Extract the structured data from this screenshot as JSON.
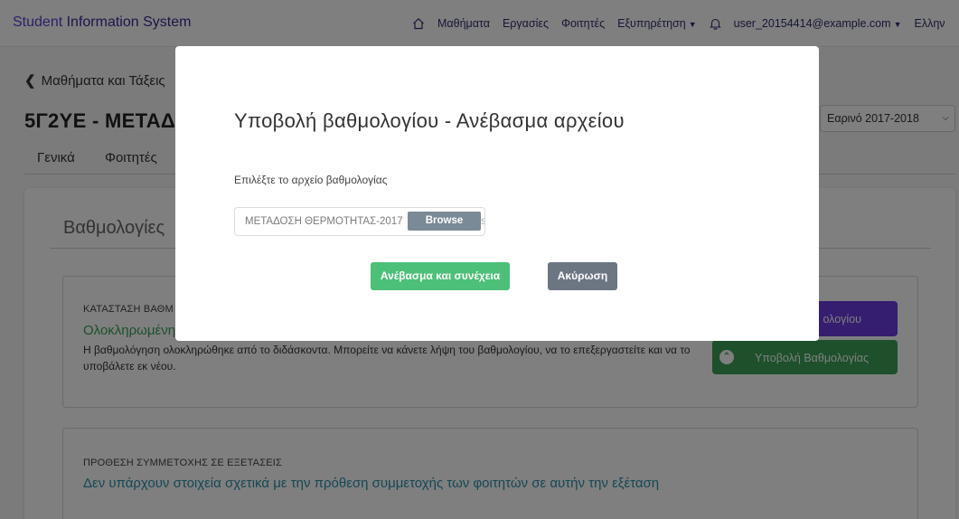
{
  "navbar": {
    "brand_part1": "Student ",
    "brand_part2": "Information System",
    "links": [
      "Μαθήματα",
      "Εργασίες",
      "Φοιτητές"
    ],
    "support_label": "Εξυπηρέτηση",
    "user_email": "user_20154414@example.com",
    "language": "Ελλην"
  },
  "page": {
    "back_label": "Μαθήματα και Τάξεις",
    "course_title": "5Γ2ΥΕ - ΜΕΤΑΔ",
    "semester": "Εαρινό 2017-2018",
    "tabs": [
      "Γενικά",
      "Φοιτητές"
    ],
    "section_title": "Βαθμολογίες",
    "status_box": {
      "label": "ΚΑΤΑΣΤΑΣΗ ΒΑΘΜ",
      "status": "Ολοκληρωμένη",
      "description": "Η βαθμολόγηση ολοκληρώθηκε από το διδάσκοντα. Μπορείτε να κάνετε λήψη του βαθμολογίου, να το επεξεργαστείτε και να το υποβάλετε εκ νέου.",
      "download_button": "ολογίου",
      "submit_button": "Υποβολή Βαθμολογίας"
    },
    "intent_box": {
      "label": "ΠΡΟΘΕΣΗ ΣΥΜΜΕΤΟΧΗΣ ΣΕ ΕΞΕΤΑΣΕΙΣ",
      "text": "Δεν υπάρχουν στοιχεία σχετικά με την πρόθεση συμμετοχής των φοιτητών σε αυτήν την εξέταση"
    }
  },
  "modal": {
    "title": "Υποβολή βαθμολογίου - Ανέβασμα αρχείου",
    "file_label": "Επιλέξτε το αρχείο βαθμολογίας",
    "file_name": "ΜΕΤΑΔΟΣΗ ΘΕΡΜΟΤΗΤΑΣ-2017",
    "file_tail": "s",
    "browse_label": "Browse",
    "submit_label": "Ανέβασμα και συνέχεια",
    "cancel_label": "Ακύρωση"
  },
  "colors": {
    "brand": "#5b3fd6",
    "accent_green": "#4cc078",
    "accent_purple": "#6a3be0",
    "cancel_gray": "#6c7683"
  }
}
